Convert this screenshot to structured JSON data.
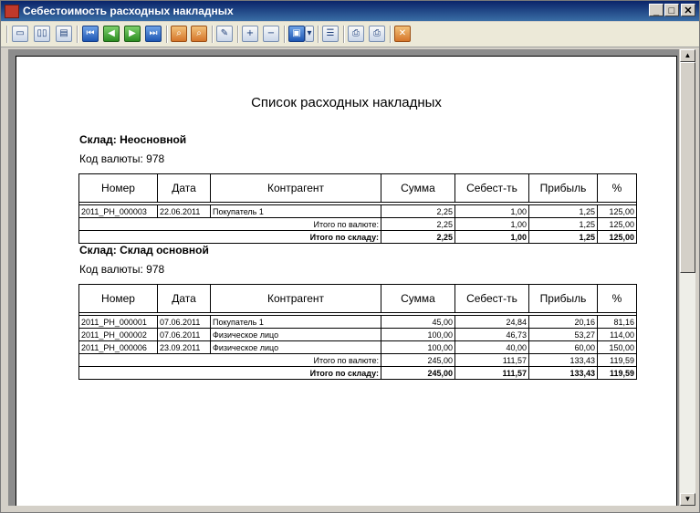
{
  "window": {
    "title": "Себестоимость расходных накладных"
  },
  "report": {
    "title": "Список расходных накладных",
    "columns": [
      "Номер",
      "Дата",
      "Контрагент",
      "Сумма",
      "Себест-ть",
      "Прибыль",
      "%"
    ],
    "warehouses": [
      {
        "title": "Склад: Неосновной",
        "currency": "Код валюты: 978",
        "rows": [
          [
            "2011_РН_000003",
            "22.06.2011",
            "Покупатель 1",
            "2,25",
            "1,00",
            "1,25",
            "125,00"
          ]
        ],
        "currency_total": {
          "label": "Итого по валюте:",
          "values": [
            "2,25",
            "1,00",
            "1,25",
            "125,00"
          ]
        },
        "warehouse_total": {
          "label": "Итого по складу:",
          "values": [
            "2,25",
            "1,00",
            "1,25",
            "125,00"
          ]
        }
      },
      {
        "title": "Склад: Склад основной",
        "currency": "Код валюты: 978",
        "rows": [
          [
            "2011_РН_000001",
            "07.06.2011",
            "Покупатель 1",
            "45,00",
            "24,84",
            "20,16",
            "81,16"
          ],
          [
            "2011_РН_000002",
            "07.06.2011",
            "Физическое лицо",
            "100,00",
            "46,73",
            "53,27",
            "114,00"
          ],
          [
            "2011_РН_000006",
            "23.09.2011",
            "Физическое лицо",
            "100,00",
            "40,00",
            "60,00",
            "150,00"
          ]
        ],
        "currency_total": {
          "label": "Итого по валюте:",
          "values": [
            "245,00",
            "111,57",
            "133,43",
            "119,59"
          ]
        },
        "warehouse_total": {
          "label": "Итого по складу:",
          "values": [
            "245,00",
            "111,57",
            "133,43",
            "119,59"
          ]
        }
      }
    ]
  },
  "toolbar": {
    "buttons": [
      "single-page-icon",
      "two-pages-icon",
      "multi-page-icon",
      "first-page-icon",
      "prev-page-icon",
      "next-page-icon",
      "last-page-icon",
      "find-icon",
      "find-next-icon",
      "edit-icon",
      "zoom-in-icon",
      "zoom-out-icon",
      "save-icon",
      "save-dropdown-icon",
      "outline-icon",
      "print-icon",
      "print-setup-icon",
      "close-icon"
    ]
  }
}
